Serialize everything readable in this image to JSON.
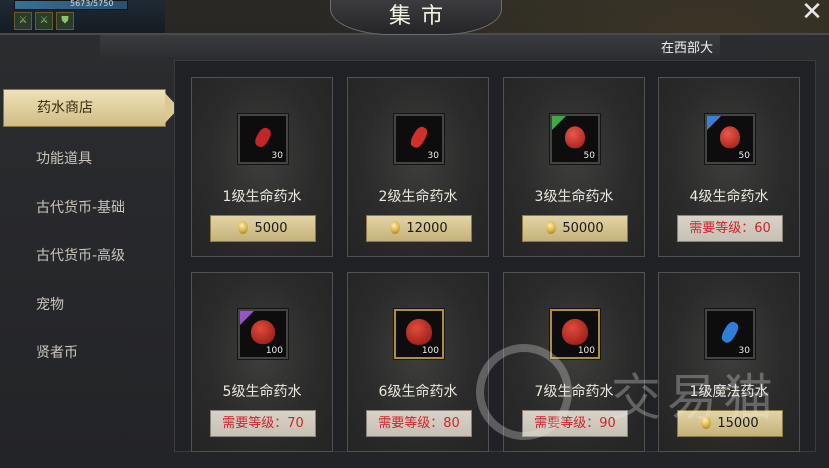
{
  "hud": {
    "hp_text": "5673/5750",
    "buffs": [
      "sword-icon",
      "sword-icon",
      "shield-icon"
    ]
  },
  "title": "集市",
  "location": "在西部大",
  "tabs": [
    {
      "label": "药水商店",
      "active": true
    },
    {
      "label": "功能道具",
      "active": false
    },
    {
      "label": "古代货币-基础",
      "active": false
    },
    {
      "label": "古代货币-高级",
      "active": false
    },
    {
      "label": "宠物",
      "active": false
    },
    {
      "label": "贤者币",
      "active": false
    }
  ],
  "items": [
    {
      "name": "1级生命药水",
      "qty": "30",
      "price": "5000",
      "requirement": "",
      "icon": "red-potion-small-icon",
      "rarity": "",
      "potion_color": "#c0262a",
      "frame": "plain"
    },
    {
      "name": "2级生命药水",
      "qty": "30",
      "price": "12000",
      "requirement": "",
      "icon": "red-potion-small-icon",
      "rarity": "",
      "potion_color": "#d0302b",
      "frame": "plain"
    },
    {
      "name": "3级生命药水",
      "qty": "50",
      "price": "50000",
      "requirement": "",
      "icon": "red-potion-flask-icon",
      "rarity": "green",
      "potion_color": "#b8201f",
      "frame": "plain"
    },
    {
      "name": "4级生命药水",
      "qty": "50",
      "price": "",
      "requirement": "需要等级：60",
      "icon": "red-potion-flask-icon",
      "rarity": "blue",
      "potion_color": "#b8201f",
      "frame": "plain"
    },
    {
      "name": "5级生命药水",
      "qty": "100",
      "price": "",
      "requirement": "需要等级：70",
      "icon": "red-potion-large-icon",
      "rarity": "purple",
      "potion_color": "#a81c1a",
      "frame": "plain"
    },
    {
      "name": "6级生命药水",
      "qty": "100",
      "price": "",
      "requirement": "需要等级：80",
      "icon": "red-potion-large-icon",
      "rarity": "",
      "potion_color": "#a81c1a",
      "frame": "gold"
    },
    {
      "name": "7级生命药水",
      "qty": "100",
      "price": "",
      "requirement": "需要等级：90",
      "icon": "red-potion-large-icon",
      "rarity": "",
      "potion_color": "#a81c1a",
      "frame": "gold"
    },
    {
      "name": "1级魔法药水",
      "qty": "30",
      "price": "15000",
      "requirement": "",
      "icon": "blue-potion-small-icon",
      "rarity": "",
      "potion_color": "#2f7ed8",
      "frame": "plain"
    }
  ],
  "watermark": "交易猫"
}
